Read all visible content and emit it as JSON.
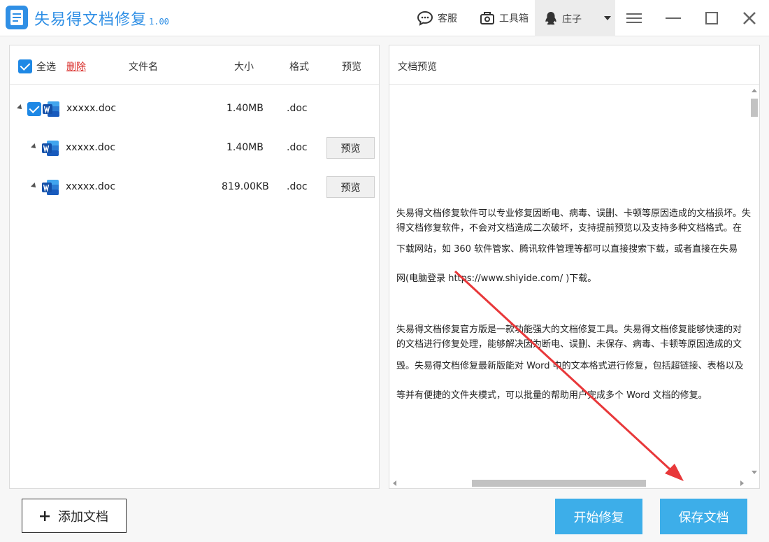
{
  "app": {
    "title": "失易得文档修复",
    "version": "1.00"
  },
  "toolbar": {
    "service_label": "客服",
    "toolbox_label": "工具箱",
    "user_name": "庄子"
  },
  "file_list": {
    "select_all_label": "全选",
    "delete_label": "删除",
    "columns": [
      "文件名",
      "大小",
      "格式",
      "预览"
    ],
    "rows": [
      {
        "name": "xxxxx.doc",
        "size": "1.40MB",
        "format": ".doc",
        "preview": ""
      },
      {
        "name": "xxxxx.doc",
        "size": "1.40MB",
        "format": ".doc",
        "preview": "预览"
      },
      {
        "name": "xxxxx.doc",
        "size": "819.00KB",
        "format": ".doc",
        "preview": "预览"
      }
    ]
  },
  "preview_panel": {
    "title": "文档预览",
    "lines": [
      "失易得文档修复软件可以专业修复因断电、病毒、误删、卡顿等原因造成的文档损坏。失",
      "得文档修复软件，不会对文档造成二次破坏，支持提前预览以及支持多种文档格式。在",
      "下载网站，如 360 软件管家、腾讯软件管理等都可以直接搜索下载，或者直接在失易",
      "网(电脑登录 https://www.shiyide.com/ )下载。",
      "失易得文档修复官方版是一款功能强大的文档修复工具。失易得文档修复能够快速的对",
      "的文档进行修复处理，能够解决因为断电、误删、未保存、病毒、卡顿等原因造成的文",
      "毁。失易得文档修复最新版能对 Word 中的文本格式进行修复，包括超链接、表格以及",
      "等并有便捷的文件夹模式，可以批量的帮助用户完成多个 Word 文档的修复。"
    ]
  },
  "actions": {
    "add_label": "添加文档",
    "start_label": "开始修复",
    "save_label": "保存文档"
  },
  "colors": {
    "accent": "#2f8fe5",
    "button_blue": "#3daee9",
    "delete_red": "#d9302c",
    "annotation_red": "#e8383a"
  }
}
